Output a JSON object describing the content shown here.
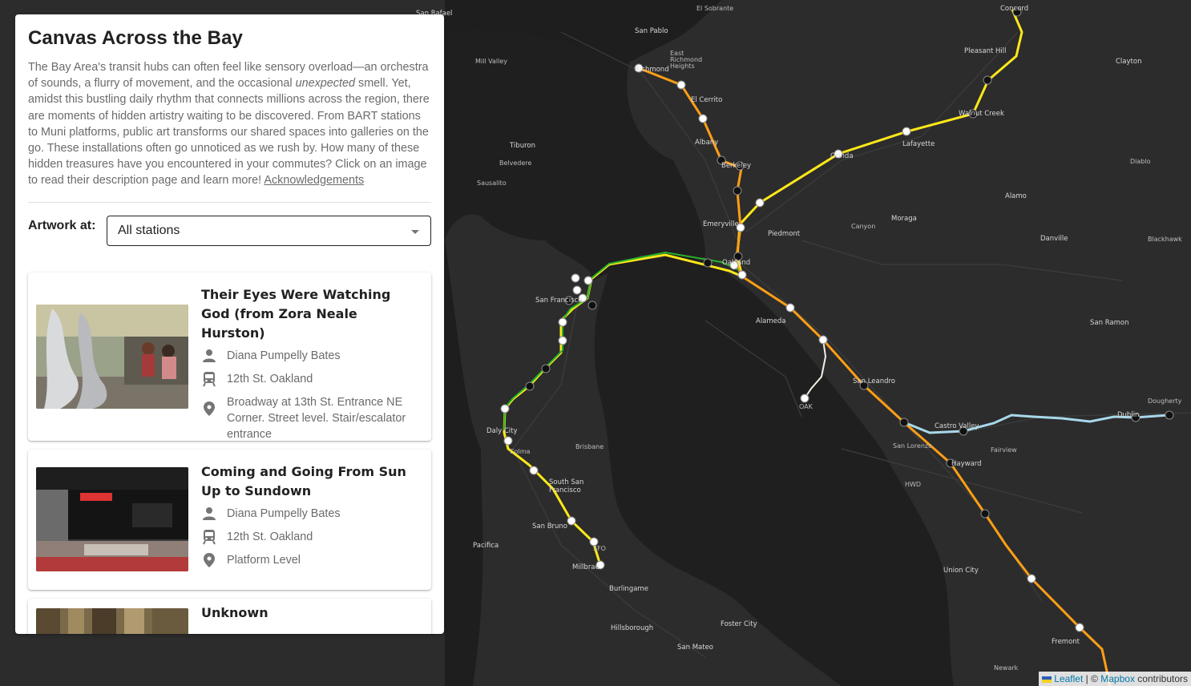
{
  "panel": {
    "title": "Canvas Across the Bay",
    "intro_prefix": "The Bay Area's transit hubs can often feel like sensory overload—an orchestra of sounds, a flurry of movement, and the occasional ",
    "intro_emphasis": "unexpected",
    "intro_suffix": " smell. Yet, amidst this bustling daily rhythm that connects millions across the region, there are moments of hidden artistry waiting to be discovered. From BART stations to Muni platforms, public art transforms our shared spaces into galleries on the go. These installations often go unnoticed as we rush by. How many of these hidden treasures have you encountered in your commutes? Click on an image to read their description page and learn more! ",
    "acknowledgements_link": "Acknowledgements",
    "filter_label": "Artwork at:",
    "filter_value": "All stations"
  },
  "artworks": [
    {
      "title": "Their Eyes Were Watching God (from Zora Neale Hurston)",
      "artist": "Diana Pumpelly Bates",
      "station": "12th St. Oakland",
      "location": "Broadway at 13th St. Entrance NE Corner. Street level. Stair/escalator entrance"
    },
    {
      "title": "Coming and Going From Sun Up to Sundown",
      "artist": "Diana Pumpelly Bates",
      "station": "12th St. Oakland",
      "location": "Platform Level"
    },
    {
      "title": "Unknown",
      "artist": "",
      "station": "",
      "location": ""
    }
  ],
  "icons": {
    "artist": "person-icon",
    "station": "train-icon",
    "location": "map-pin-icon",
    "dropdown": "chevron-down-icon"
  },
  "map": {
    "places": [
      "San Rafael",
      "San Pablo",
      "El Sobrante",
      "East Richmond Heights",
      "Richmond",
      "El Cerrito",
      "Albany",
      "Berkeley",
      "Emeryville",
      "Oakland",
      "Piedmont",
      "Alameda",
      "San Francisco",
      "Daly City",
      "South San Francisco",
      "San Bruno",
      "Millbrae",
      "Burlingame",
      "Hillsborough",
      "San Mateo",
      "Foster City",
      "Pacifica",
      "San Leandro",
      "Castro Valley",
      "Hayward",
      "Union City",
      "Fremont",
      "Concord",
      "Pleasant Hill",
      "Walnut Creek",
      "Lafayette",
      "Orinda",
      "Moraga",
      "Danville",
      "San Ramon",
      "Dublin",
      "Clayton",
      "Alamo",
      "Tiburon",
      "Sausalito",
      "Belvedere",
      "Mill Valley",
      "San Lorenzo",
      "Canyon",
      "Newark",
      "Brisbane",
      "Colma",
      "Blackhawk",
      "Diablo",
      "Dougherty",
      "Fairview",
      "HWD",
      "OAK",
      "SFO"
    ],
    "colors": {
      "yellow": "#ffe81a",
      "orange": "#ff9e16",
      "green": "#27b22b",
      "blue": "#a8d8ea",
      "white": "#f2efe6",
      "water": "#1e1e1e",
      "land": "#2b2b2b"
    }
  },
  "attribution": {
    "leaflet": "Leaflet",
    "separator": " | © ",
    "mapbox": "Mapbox",
    "suffix": " contributors"
  }
}
